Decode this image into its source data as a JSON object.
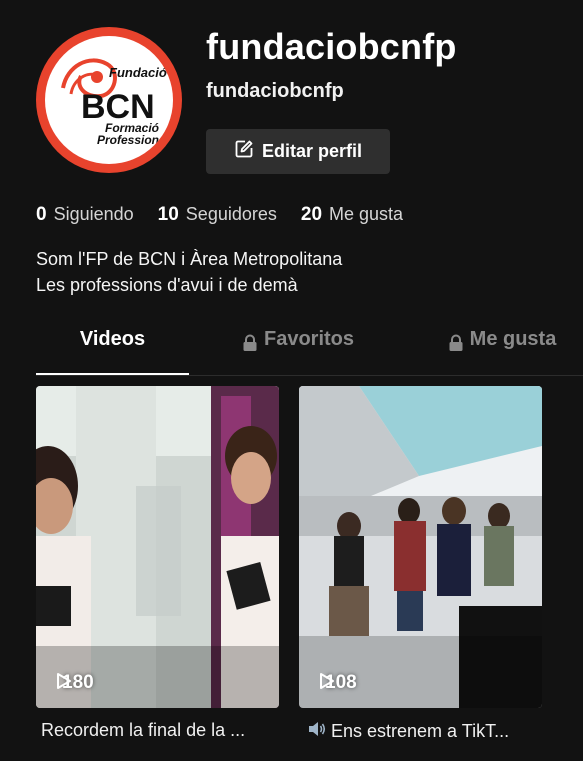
{
  "profile": {
    "username": "fundaciobcnfp",
    "subname": "fundaciobcnfp",
    "edit_label": "Editar perfil",
    "avatar_ring_color": "#e8432d"
  },
  "stats": [
    {
      "value": "0",
      "label": "Siguiendo"
    },
    {
      "value": "10",
      "label": "Seguidores"
    },
    {
      "value": "20",
      "label": "Me gusta"
    }
  ],
  "bio": {
    "line1": "Som l'FP de BCN i Àrea Metropolitana",
    "line2": "Les professions d'avui i de demà"
  },
  "tabs": [
    {
      "label": "Videos",
      "active": true,
      "locked": false
    },
    {
      "label": "Favoritos",
      "active": false,
      "locked": true
    },
    {
      "label": "Me gusta",
      "active": false,
      "locked": true
    }
  ],
  "videos": [
    {
      "views": "180",
      "caption": "Recordem la final de la ...",
      "icon": "none"
    },
    {
      "views": "108",
      "caption": "Ens estrenem a TikT...",
      "icon": "speaker-icon"
    }
  ]
}
